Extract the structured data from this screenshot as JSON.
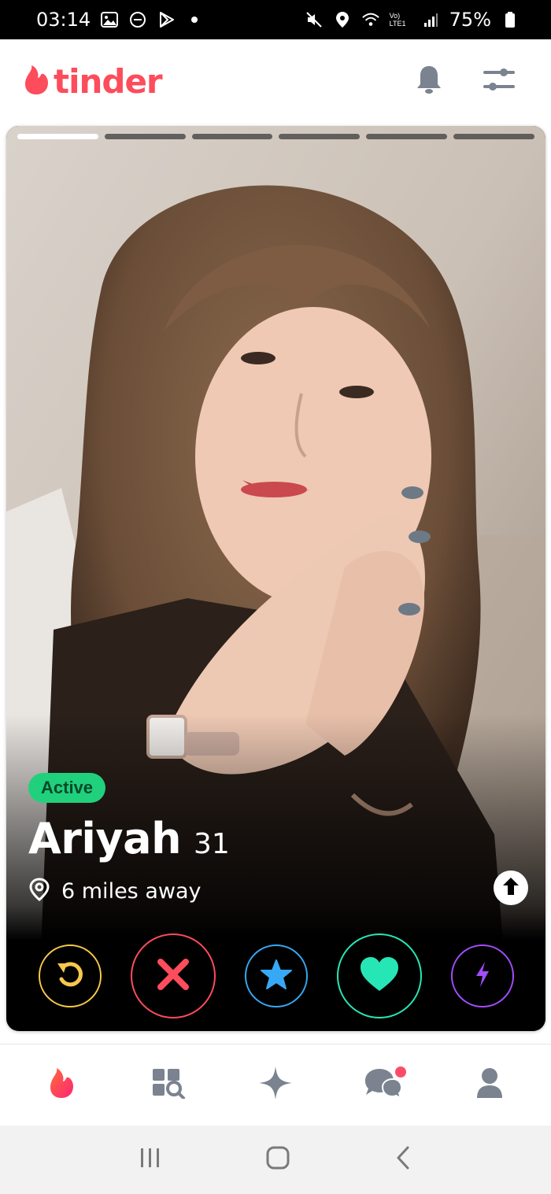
{
  "status_bar": {
    "time": "03:14",
    "battery": "75%",
    "icons": [
      "image-icon",
      "dnd-icon",
      "play-icon",
      "dot-icon",
      "mute-icon",
      "location-icon",
      "wifi-icon",
      "signal-icon",
      "battery-icon"
    ],
    "network_label": "Vo) LTE1"
  },
  "header": {
    "brand": "tinder",
    "brand_color": "#fd4c5c",
    "icons": [
      "bell-icon",
      "filters-icon"
    ]
  },
  "card": {
    "photo_segments": 6,
    "active_segment": 1,
    "badge": "Active",
    "badge_color": "#21d07c",
    "name": "Ariyah",
    "age": "31",
    "location": "6 miles away",
    "icons": [
      "location-pin-icon",
      "arrow-up-icon"
    ]
  },
  "actions": [
    {
      "name": "rewind",
      "icon": "rewind-icon",
      "color": "#f6c84d"
    },
    {
      "name": "nope",
      "icon": "x-icon",
      "color": "#fd4c5c"
    },
    {
      "name": "super-like",
      "icon": "star-icon",
      "color": "#37a8f5"
    },
    {
      "name": "like",
      "icon": "heart-icon",
      "color": "#27e6b6"
    },
    {
      "name": "boost",
      "icon": "bolt-icon",
      "color": "#a24dff"
    }
  ],
  "bottom_nav": [
    {
      "name": "discover",
      "icon": "flame-icon",
      "active": true
    },
    {
      "name": "explore",
      "icon": "explore-icon",
      "active": false
    },
    {
      "name": "top-picks",
      "icon": "sparkle-icon",
      "active": false
    },
    {
      "name": "messages",
      "icon": "chat-icon",
      "active": false,
      "notification": true
    },
    {
      "name": "profile",
      "icon": "profile-icon",
      "active": false
    }
  ],
  "system_nav": [
    "recents-icon",
    "home-icon",
    "back-icon"
  ]
}
